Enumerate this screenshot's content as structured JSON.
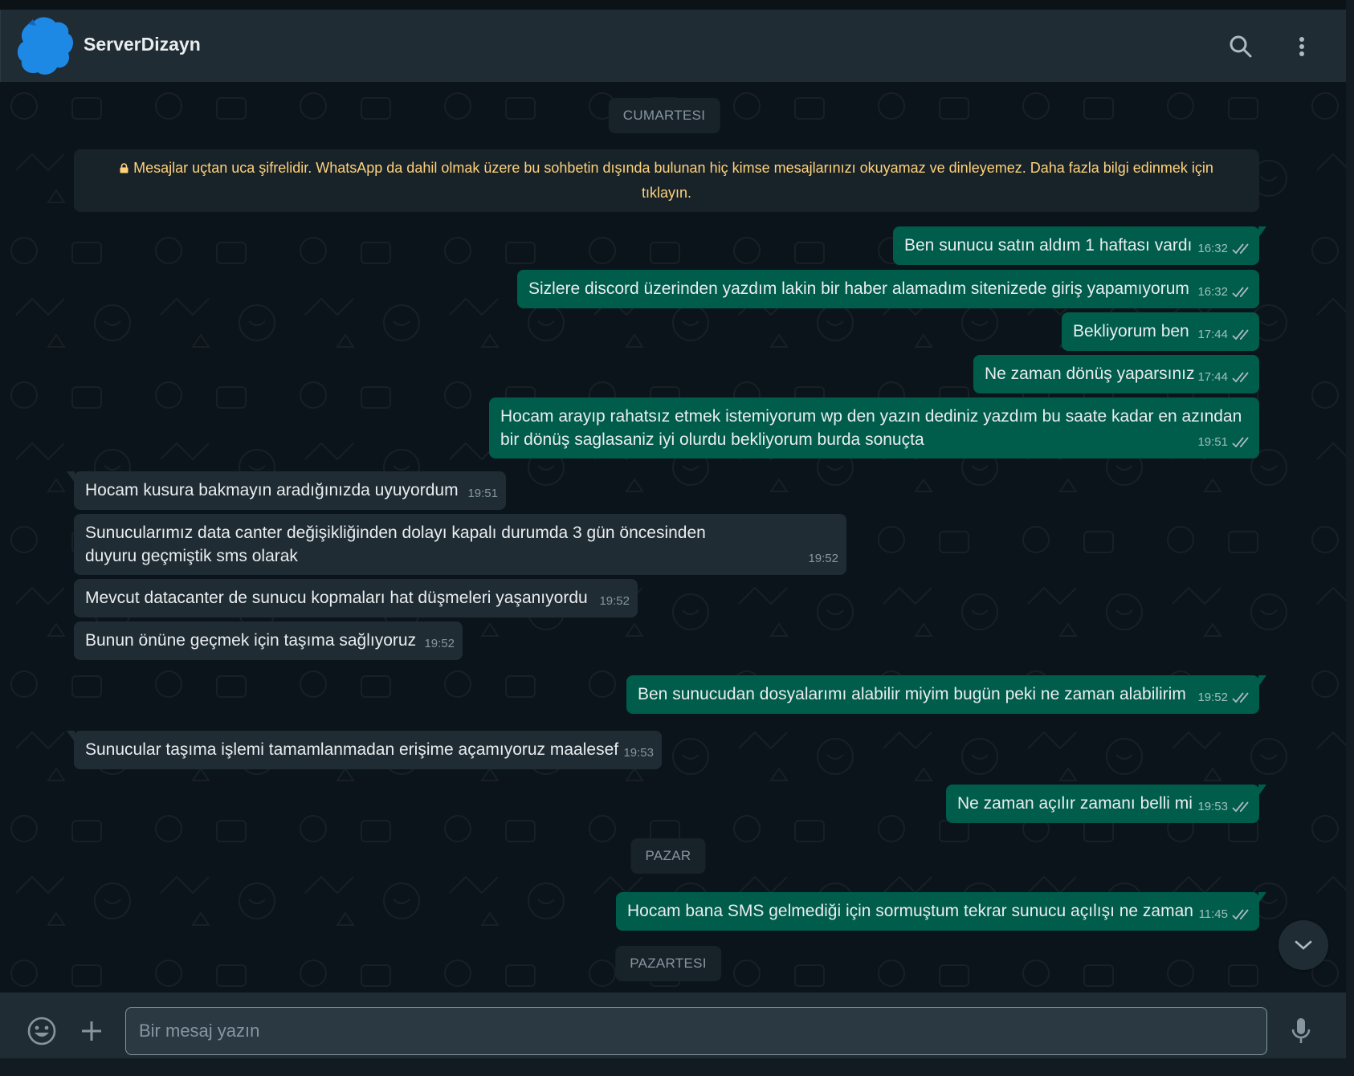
{
  "header": {
    "contact_name": "ServerDizayn",
    "icons": [
      "search-icon",
      "menu-dots-icon"
    ]
  },
  "chat": {
    "day_labels": [
      "CUMARTESI",
      "PAZAR",
      "PAZARTESI"
    ],
    "encryption_notice": "Mesajlar uçtan uca şifrelidir. WhatsApp da dahil olmak üzere bu sohbetin dışında bulunan hiç kimse mesajlarınızı okuyamaz ve dinleyemez. Daha fazla bilgi edinmek için tıklayın.",
    "messages": [
      {
        "dir": "out",
        "text": "Ben sunucu satın aldım 1 haftası vardı",
        "time": "16:32",
        "status": "read"
      },
      {
        "dir": "out",
        "text": "Sizlere discord üzerinden yazdım lakin bir haber alamadım sitenizede giriş yapamıyorum",
        "time": "16:32",
        "status": "read"
      },
      {
        "dir": "out",
        "text": "Bekliyorum ben",
        "time": "17:44",
        "status": "read"
      },
      {
        "dir": "out",
        "text": "Ne zaman dönüş yaparsınız",
        "time": "17:44",
        "status": "read"
      },
      {
        "dir": "out",
        "text": "Hocam arayıp rahatsız etmek istemiyorum wp den yazın dediniz yazdım bu saate kadar en azından bir dönüş saglasaniz iyi olurdu bekliyorum burda sonuçta",
        "time": "19:51",
        "status": "read"
      },
      {
        "dir": "in",
        "text": "Hocam kusura bakmayın aradığınızda uyuyordum",
        "time": "19:51"
      },
      {
        "dir": "in",
        "text": "Sunucularımız data canter değişikliğinden dolayı kapalı durumda 3 gün öncesinden duyuru geçmiştik sms olarak",
        "time": "19:52"
      },
      {
        "dir": "in",
        "text": "Mevcut datacanter de sunucu kopmaları hat düşmeleri yaşanıyordu",
        "time": "19:52"
      },
      {
        "dir": "in",
        "text": "Bunun önüne geçmek için taşıma sağlıyoruz",
        "time": "19:52"
      },
      {
        "dir": "out",
        "text": "Ben sunucudan dosyalarımı alabilir miyim bugün peki ne zaman alabilirim",
        "time": "19:52",
        "status": "read"
      },
      {
        "dir": "in",
        "text": "Sunucular taşıma işlemi tamamlanmadan erişime açamıyoruz maalesef",
        "time": "19:53"
      },
      {
        "dir": "out",
        "text": "Ne zaman açılır zamanı belli mi",
        "time": "19:53",
        "status": "read"
      },
      {
        "dir": "out",
        "text": "Hocam bana SMS gelmediği için sormuştum tekrar sunucu açılışı ne zaman",
        "time": "11:45",
        "status": "read"
      }
    ]
  },
  "composer": {
    "placeholder": "Bir mesaj yazın",
    "value": "",
    "icons": [
      "emoji-icon",
      "plus-icon",
      "microphone-icon"
    ]
  },
  "colors": {
    "outgoing_bubble": "#005c4b",
    "incoming_bubble": "#202c33",
    "background": "#0b141a",
    "header": "#202c33",
    "notice_text": "#ffd279",
    "avatar": "#1e88e5"
  }
}
